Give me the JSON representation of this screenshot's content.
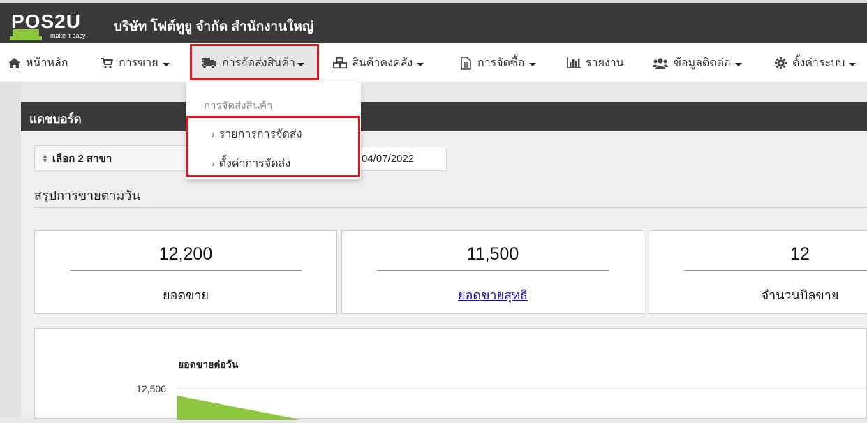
{
  "header": {
    "logo_text": "POS2U",
    "logo_tagline": "make it easy",
    "company": "บริษัท โฟต์ทูยู จำกัด สำนักงานใหญ่"
  },
  "nav": {
    "home": "หน้าหลัก",
    "sales": "การขาย",
    "delivery": "การจัดส่งสินค้า",
    "inventory": "สินค้าคงคลัง",
    "purchasing": "การจัดซื้อ",
    "reports": "รายงาน",
    "contacts": "ข้อมูลติดต่อ",
    "settings": "ตั้งค่าระบบ"
  },
  "dropdown": {
    "header": "การจัดส่งสินค้า",
    "items": [
      "รายการการจัดส่ง",
      "ตั้งค่าการจัดส่ง"
    ]
  },
  "dashboard": {
    "title": "แดชบอร์ด",
    "branch_select": "เลือก 2 สาขา",
    "date": "04/07/2022",
    "section_title": "สรุปการขายตามวัน",
    "stats": [
      {
        "value": "12,200",
        "label": "ยอดขาย"
      },
      {
        "value": "11,500",
        "label": "ยอดขายสุทธิ"
      },
      {
        "value": "12",
        "label": "จำนวนบิลขาย"
      }
    ]
  },
  "chart_data": {
    "type": "area",
    "title": "ยอดขายต่อวัน",
    "y_ticks": [
      "12,500"
    ],
    "series_color": "#8dc63f"
  },
  "colors": {
    "header_bg": "#3a3a3a",
    "highlight": "#e0161e",
    "logo_green": "#8dc63f",
    "link": "#1a0dab"
  }
}
